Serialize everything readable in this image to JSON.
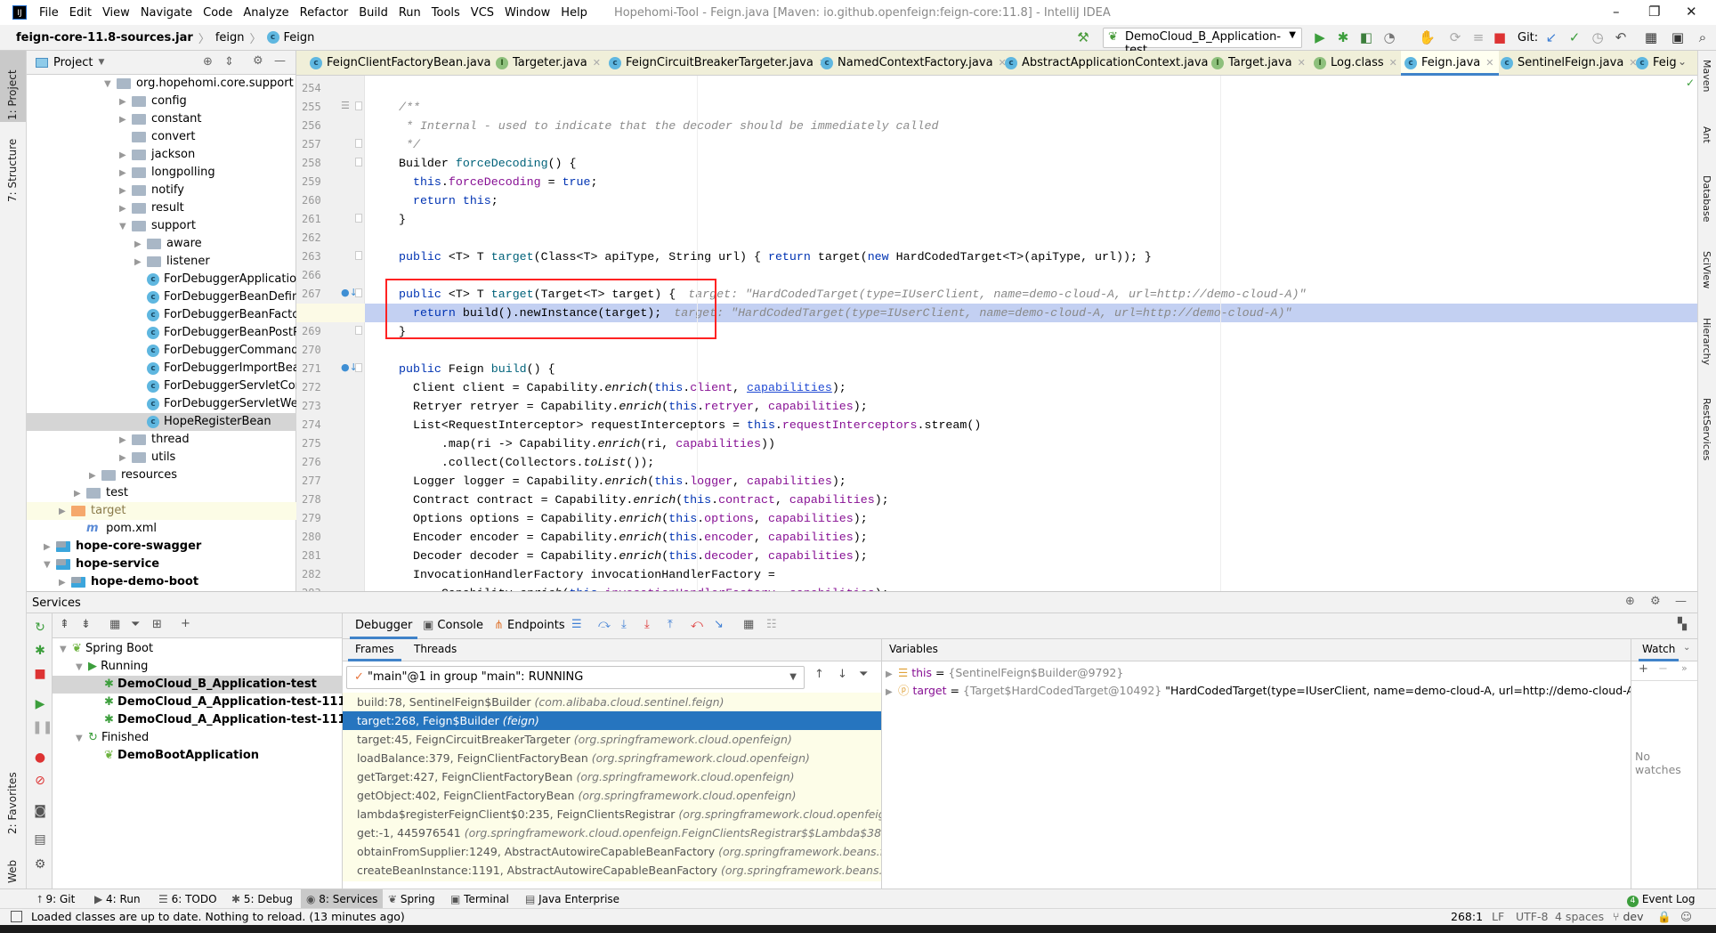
{
  "window": {
    "title": "Hopehomi-Tool - Feign.java [Maven: io.github.openfeign:feign-core:11.8] - IntelliJ IDEA",
    "menu": [
      "File",
      "Edit",
      "View",
      "Navigate",
      "Code",
      "Analyze",
      "Refactor",
      "Build",
      "Run",
      "Tools",
      "VCS",
      "Window",
      "Help"
    ],
    "controls": {
      "minimize": "–",
      "maximize": "❐",
      "close": "✕"
    }
  },
  "navbar": {
    "breadcrumbs": [
      "feign-core-11.8-sources.jar",
      "feign",
      "Feign"
    ],
    "run_config": "DemoCloud_B_Application-test",
    "git_label": "Git:"
  },
  "left_stripe": [
    "1: Project",
    "7: Structure",
    "2: Favorites",
    "Web"
  ],
  "right_stripe": [
    "Maven",
    "Ant",
    "Database",
    "SciView",
    "Hierarchy",
    "RestServices"
  ],
  "project": {
    "title": "Project",
    "tree": [
      {
        "label": "org.hopehomi.core.support",
        "depth": 5,
        "arrow": "▼",
        "icon": "folder"
      },
      {
        "label": "config",
        "depth": 6,
        "arrow": "▶",
        "icon": "folder"
      },
      {
        "label": "constant",
        "depth": 6,
        "arrow": "▶",
        "icon": "folder"
      },
      {
        "label": "convert",
        "depth": 6,
        "arrow": "",
        "icon": "folder"
      },
      {
        "label": "jackson",
        "depth": 6,
        "arrow": "▶",
        "icon": "folder"
      },
      {
        "label": "longpolling",
        "depth": 6,
        "arrow": "▶",
        "icon": "folder"
      },
      {
        "label": "notify",
        "depth": 6,
        "arrow": "▶",
        "icon": "folder"
      },
      {
        "label": "result",
        "depth": 6,
        "arrow": "▶",
        "icon": "folder"
      },
      {
        "label": "support",
        "depth": 6,
        "arrow": "▼",
        "icon": "folder"
      },
      {
        "label": "aware",
        "depth": 7,
        "arrow": "▶",
        "icon": "folder"
      },
      {
        "label": "listener",
        "depth": 7,
        "arrow": "▶",
        "icon": "folder"
      },
      {
        "label": "ForDebuggerApplication",
        "depth": 7,
        "arrow": "",
        "icon": "class"
      },
      {
        "label": "ForDebuggerBeanDefini",
        "depth": 7,
        "arrow": "",
        "icon": "class"
      },
      {
        "label": "ForDebuggerBeanFacto",
        "depth": 7,
        "arrow": "",
        "icon": "class"
      },
      {
        "label": "ForDebuggerBeanPostP",
        "depth": 7,
        "arrow": "",
        "icon": "class"
      },
      {
        "label": "ForDebuggerCommand",
        "depth": 7,
        "arrow": "",
        "icon": "class"
      },
      {
        "label": "ForDebuggerImportBea",
        "depth": 7,
        "arrow": "",
        "icon": "class"
      },
      {
        "label": "ForDebuggerServletCon",
        "depth": 7,
        "arrow": "",
        "icon": "class"
      },
      {
        "label": "ForDebuggerServletWel",
        "depth": 7,
        "arrow": "",
        "icon": "class"
      },
      {
        "label": "HopeRegisterBean",
        "depth": 7,
        "arrow": "",
        "icon": "class",
        "selected": true
      },
      {
        "label": "thread",
        "depth": 6,
        "arrow": "▶",
        "icon": "folder"
      },
      {
        "label": "utils",
        "depth": 6,
        "arrow": "▶",
        "icon": "folder"
      },
      {
        "label": "resources",
        "depth": 4,
        "arrow": "▶",
        "icon": "folder"
      },
      {
        "label": "test",
        "depth": 3,
        "arrow": "▶",
        "icon": "folder"
      },
      {
        "label": "target",
        "depth": 2,
        "arrow": "▶",
        "icon": "folder-orange",
        "excluded": true
      },
      {
        "label": "pom.xml",
        "depth": 3,
        "arrow": "",
        "icon": "maven"
      },
      {
        "label": "hope-core-swagger",
        "depth": 1,
        "arrow": "▶",
        "icon": "module",
        "bold": true
      },
      {
        "label": "hope-service",
        "depth": 1,
        "arrow": "▼",
        "icon": "module",
        "bold": true
      },
      {
        "label": "hope-demo-boot",
        "depth": 2,
        "arrow": "▶",
        "icon": "module",
        "bold": true
      }
    ]
  },
  "tabs": [
    {
      "label": "FeignClientFactoryBean.java",
      "kind": "C"
    },
    {
      "label": "Targeter.java",
      "kind": "I"
    },
    {
      "label": "FeignCircuitBreakerTargeter.java",
      "kind": "C"
    },
    {
      "label": "NamedContextFactory.java",
      "kind": "C"
    },
    {
      "label": "AbstractApplicationContext.java",
      "kind": "C"
    },
    {
      "label": "Target.java",
      "kind": "I"
    },
    {
      "label": "Log.class",
      "kind": "I"
    },
    {
      "label": "Feign.java",
      "kind": "C",
      "active": true
    },
    {
      "label": "SentinelFeign.java",
      "kind": "C"
    },
    {
      "label": "Feig",
      "kind": "C"
    }
  ],
  "editor": {
    "current_line": 268,
    "lines": [
      {
        "n": "254",
        "segs": []
      },
      {
        "n": "255",
        "segs": [
          [
            "/**",
            "cm"
          ]
        ]
      },
      {
        "n": "256",
        "segs": [
          [
            " * Internal - used to indicate that the decoder should be immediately called",
            "cm"
          ]
        ]
      },
      {
        "n": "257",
        "segs": [
          [
            " */",
            "cm"
          ]
        ]
      },
      {
        "n": "258",
        "segs": [
          [
            "Builder ",
            ""
          ],
          [
            "forceDecoding",
            "mth"
          ],
          [
            "() {",
            ""
          ]
        ]
      },
      {
        "n": "259",
        "segs": [
          [
            "  ",
            ""
          ],
          [
            "this",
            "kw"
          ],
          [
            ".",
            ""
          ],
          [
            "forceDecoding",
            "fld"
          ],
          [
            " = ",
            ""
          ],
          [
            "true",
            "kw"
          ],
          [
            ";",
            ""
          ]
        ]
      },
      {
        "n": "260",
        "segs": [
          [
            "  ",
            ""
          ],
          [
            "return",
            "kw"
          ],
          [
            " ",
            ""
          ],
          [
            "this",
            "kw"
          ],
          [
            ";",
            ""
          ]
        ]
      },
      {
        "n": "261",
        "segs": [
          [
            "}",
            ""
          ]
        ]
      },
      {
        "n": "262",
        "segs": []
      },
      {
        "n": "263",
        "segs": [
          [
            "public",
            "kw"
          ],
          [
            " <T> T ",
            ""
          ],
          [
            "target",
            "mth"
          ],
          [
            "(Class<T> apiType, String url) { ",
            ""
          ],
          [
            "return",
            "kw"
          ],
          [
            " target(",
            ""
          ],
          [
            "new",
            "kw"
          ],
          [
            " HardCodedTarget<T>(apiType, url)); }",
            ""
          ]
        ]
      },
      {
        "n": "266",
        "segs": []
      },
      {
        "n": "267",
        "segs": [
          [
            "public",
            "kw"
          ],
          [
            " <T> T ",
            ""
          ],
          [
            "target",
            "mth"
          ],
          [
            "(Target<T> target) {",
            ""
          ]
        ],
        "hint": "target: \"HardCodedTarget(type=IUserClient, name=demo-cloud-A, url=http://demo-cloud-A)\""
      },
      {
        "n": "268",
        "segs": [
          [
            "  ",
            ""
          ],
          [
            "return",
            "kw"
          ],
          [
            " build().newInstance(target);",
            ""
          ]
        ],
        "hint": "target: \"HardCodedTarget(type=IUserClient, name=demo-cloud-A, url=http://demo-cloud-A)\"",
        "current": true
      },
      {
        "n": "269",
        "segs": [
          [
            "}",
            ""
          ]
        ]
      },
      {
        "n": "270",
        "segs": []
      },
      {
        "n": "271",
        "segs": [
          [
            "public",
            "kw"
          ],
          [
            " Feign ",
            ""
          ],
          [
            "build",
            "mth"
          ],
          [
            "() {",
            ""
          ]
        ]
      },
      {
        "n": "272",
        "segs": [
          [
            "  Client client = Capability.",
            ""
          ],
          [
            "enrich",
            "it"
          ],
          [
            "(",
            ""
          ],
          [
            "this",
            "kw"
          ],
          [
            ".",
            ""
          ],
          [
            "client",
            "fld"
          ],
          [
            ", ",
            ""
          ],
          [
            "capabilities",
            "lnk"
          ],
          [
            ");",
            ""
          ]
        ]
      },
      {
        "n": "273",
        "segs": [
          [
            "  Retryer retryer = Capability.",
            ""
          ],
          [
            "enrich",
            "it"
          ],
          [
            "(",
            ""
          ],
          [
            "this",
            "kw"
          ],
          [
            ".",
            ""
          ],
          [
            "retryer",
            "fld"
          ],
          [
            ", ",
            ""
          ],
          [
            "capabilities",
            "fld"
          ],
          [
            ");",
            ""
          ]
        ]
      },
      {
        "n": "274",
        "segs": [
          [
            "  List<RequestInterceptor> requestInterceptors = ",
            ""
          ],
          [
            "this",
            "kw"
          ],
          [
            ".",
            ""
          ],
          [
            "requestInterceptors",
            "fld"
          ],
          [
            ".stream()",
            ""
          ]
        ]
      },
      {
        "n": "275",
        "segs": [
          [
            "      .map(ri -> Capability.",
            ""
          ],
          [
            "enrich",
            "it"
          ],
          [
            "(ri, ",
            ""
          ],
          [
            "capabilities",
            "fld"
          ],
          [
            "))",
            ""
          ]
        ]
      },
      {
        "n": "276",
        "segs": [
          [
            "      .collect(Collectors.",
            ""
          ],
          [
            "toList",
            "it"
          ],
          [
            "());",
            ""
          ]
        ]
      },
      {
        "n": "277",
        "segs": [
          [
            "  Logger logger = Capability.",
            ""
          ],
          [
            "enrich",
            "it"
          ],
          [
            "(",
            ""
          ],
          [
            "this",
            "kw"
          ],
          [
            ".",
            ""
          ],
          [
            "logger",
            "fld"
          ],
          [
            ", ",
            ""
          ],
          [
            "capabilities",
            "fld"
          ],
          [
            ");",
            ""
          ]
        ]
      },
      {
        "n": "278",
        "segs": [
          [
            "  Contract contract = Capability.",
            ""
          ],
          [
            "enrich",
            "it"
          ],
          [
            "(",
            ""
          ],
          [
            "this",
            "kw"
          ],
          [
            ".",
            ""
          ],
          [
            "contract",
            "fld"
          ],
          [
            ", ",
            ""
          ],
          [
            "capabilities",
            "fld"
          ],
          [
            ");",
            ""
          ]
        ]
      },
      {
        "n": "279",
        "segs": [
          [
            "  Options options = Capability.",
            ""
          ],
          [
            "enrich",
            "it"
          ],
          [
            "(",
            ""
          ],
          [
            "this",
            "kw"
          ],
          [
            ".",
            ""
          ],
          [
            "options",
            "fld"
          ],
          [
            ", ",
            ""
          ],
          [
            "capabilities",
            "fld"
          ],
          [
            ");",
            ""
          ]
        ]
      },
      {
        "n": "280",
        "segs": [
          [
            "  Encoder encoder = Capability.",
            ""
          ],
          [
            "enrich",
            "it"
          ],
          [
            "(",
            ""
          ],
          [
            "this",
            "kw"
          ],
          [
            ".",
            ""
          ],
          [
            "encoder",
            "fld"
          ],
          [
            ", ",
            ""
          ],
          [
            "capabilities",
            "fld"
          ],
          [
            ");",
            ""
          ]
        ]
      },
      {
        "n": "281",
        "segs": [
          [
            "  Decoder decoder = Capability.",
            ""
          ],
          [
            "enrich",
            "it"
          ],
          [
            "(",
            ""
          ],
          [
            "this",
            "kw"
          ],
          [
            ".",
            ""
          ],
          [
            "decoder",
            "fld"
          ],
          [
            ", ",
            ""
          ],
          [
            "capabilities",
            "fld"
          ],
          [
            ");",
            ""
          ]
        ]
      },
      {
        "n": "282",
        "segs": [
          [
            "  InvocationHandlerFactory invocationHandlerFactory =",
            ""
          ]
        ]
      },
      {
        "n": "283",
        "segs": [
          [
            "      Capability.",
            ""
          ],
          [
            "enrich",
            "it"
          ],
          [
            "(",
            ""
          ],
          [
            "this",
            "kw"
          ],
          [
            ".",
            ""
          ],
          [
            "invocationHandlerFactory",
            "fld"
          ],
          [
            ", ",
            ""
          ],
          [
            "capabilities",
            "fld"
          ],
          [
            ");",
            ""
          ]
        ]
      }
    ]
  },
  "services": {
    "title": "Services",
    "tree": [
      {
        "label": "Spring Boot",
        "depth": 0,
        "arrow": "▼",
        "icon": "spring"
      },
      {
        "label": "Running",
        "depth": 1,
        "arrow": "▼",
        "icon": "run"
      },
      {
        "label": "DemoCloud_B_Application-test",
        "depth": 2,
        "icon": "bug",
        "bold": true,
        "selected": true,
        "port": ""
      },
      {
        "label": "DemoCloud_A_Application-test-1112",
        "depth": 2,
        "icon": "bug",
        "bold": true,
        "port": ":111"
      },
      {
        "label": "DemoCloud_A_Application-test-1114",
        "depth": 2,
        "icon": "bug",
        "bold": true,
        "port": ":111"
      },
      {
        "label": "Finished",
        "depth": 1,
        "arrow": "▼",
        "icon": "rerun"
      },
      {
        "label": "DemoBootApplication",
        "depth": 2,
        "icon": "spring",
        "bold": true,
        "port": ""
      }
    ]
  },
  "debugger": {
    "tabs": [
      "Debugger",
      "Console",
      "Endpoints"
    ],
    "subtabs": [
      "Frames",
      "Threads"
    ],
    "thread": "\"main\"@1 in group \"main\": RUNNING",
    "frames": [
      {
        "m": "build:78, SentinelFeign$Builder",
        "p": "(com.alibaba.cloud.sentinel.feign)"
      },
      {
        "m": "target:268, Feign$Builder",
        "p": "(feign)",
        "selected": true
      },
      {
        "m": "target:45, FeignCircuitBreakerTargeter",
        "p": "(org.springframework.cloud.openfeign)"
      },
      {
        "m": "loadBalance:379, FeignClientFactoryBean",
        "p": "(org.springframework.cloud.openfeign)"
      },
      {
        "m": "getTarget:427, FeignClientFactoryBean",
        "p": "(org.springframework.cloud.openfeign)"
      },
      {
        "m": "getObject:402, FeignClientFactoryBean",
        "p": "(org.springframework.cloud.openfeign)"
      },
      {
        "m": "lambda$registerFeignClient$0:235, FeignClientsRegistrar",
        "p": "(org.springframework.cloud.openfeign)"
      },
      {
        "m": "get:-1, 445976541",
        "p": "(org.springframework.cloud.openfeign.FeignClientsRegistrar$$Lambda$387)"
      },
      {
        "m": "obtainFromSupplier:1249, AbstractAutowireCapableBeanFactory",
        "p": "(org.springframework.beans.factory.support)"
      },
      {
        "m": "createBeanInstance:1191, AbstractAutowireCapableBeanFactory",
        "p": "(org.springframework.beans.factory.support)"
      },
      {
        "m": "doCreateBean:582, AbstractAutowireCapableBeanFactory",
        "p": "(org.springframework.beans.factory.support)"
      }
    ],
    "variables_title": "Variables",
    "variables": [
      {
        "icon": "field-icon",
        "name": "this",
        "type": "{SentinelFeign$Builder@9792}",
        "value": ""
      },
      {
        "icon": "param-icon",
        "name": "target",
        "type": "{Target$HardCodedTarget@10492}",
        "value": "\"HardCodedTarget(type=IUserClient, name=demo-cloud-A, url=http://demo-cloud-A)\""
      }
    ],
    "watch_title": "Watch",
    "no_watches": "No watches"
  },
  "bottom_tabs": [
    {
      "label": "9: Git",
      "icon": "⭡"
    },
    {
      "label": "4: Run",
      "icon": "▶"
    },
    {
      "label": "6: TODO",
      "icon": "☰"
    },
    {
      "label": "5: Debug",
      "icon": "✱"
    },
    {
      "label": "8: Services",
      "icon": "◉",
      "active": true
    },
    {
      "label": "Spring",
      "icon": "❦"
    },
    {
      "label": "Terminal",
      "icon": "▣"
    },
    {
      "label": "Java Enterprise",
      "icon": "▤"
    }
  ],
  "event_log": {
    "label": "Event Log",
    "count": "4"
  },
  "status": {
    "message": "Loaded classes are up to date. Nothing to reload. (13 minutes ago)",
    "position": "268:1",
    "line_sep": "LF",
    "encoding": "UTF-8",
    "indent": "4 spaces",
    "branch": "dev"
  },
  "colors": {
    "accent": "#4083c9",
    "selection": "#2675bf",
    "current_line": "#c3d0f2",
    "highlight_box": "#ff2222"
  }
}
